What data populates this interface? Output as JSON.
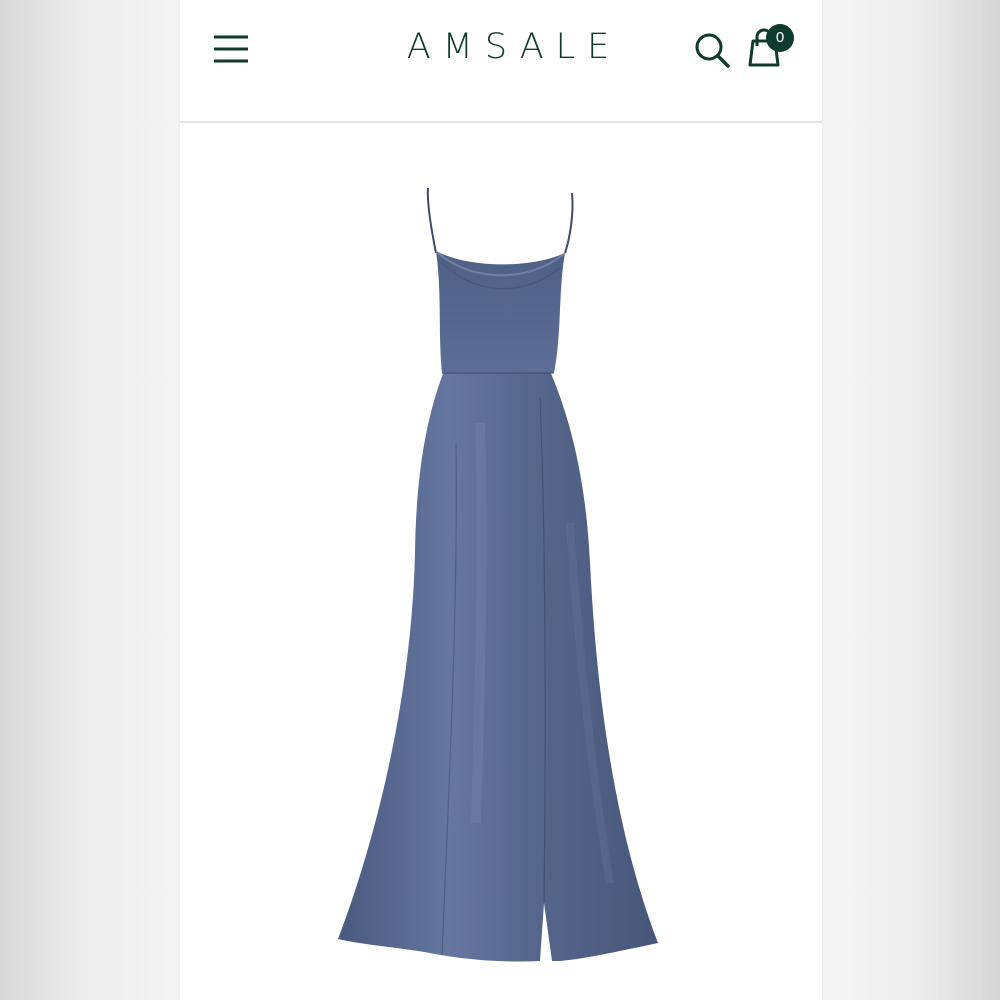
{
  "header": {
    "brand_logo": "AMSALE",
    "menu_icon": "hamburger-menu-icon",
    "search_icon": "search-icon",
    "cart_icon": "shopping-bag-icon",
    "cart_count": "0"
  },
  "product": {
    "image": "slate-blue-satin-cowl-neck-gown-with-side-slit",
    "dress_color": "#56678c"
  },
  "colors": {
    "brand": "#0f3b2e",
    "background": "#ffffff"
  }
}
